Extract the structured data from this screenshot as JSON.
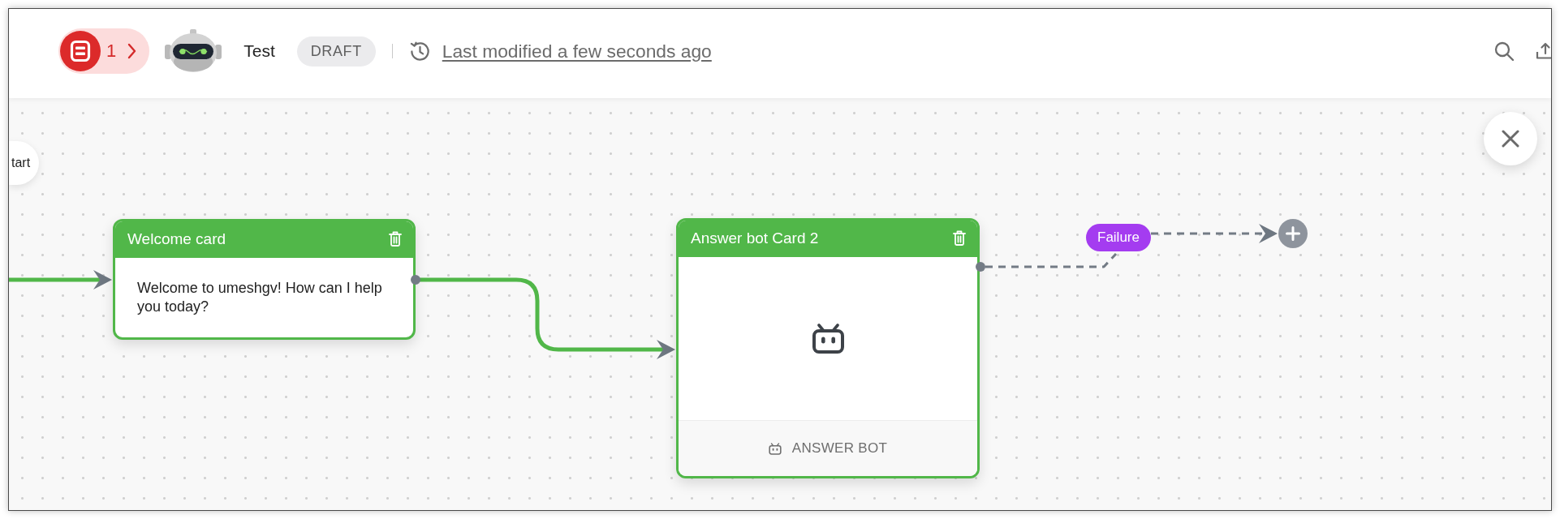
{
  "header": {
    "issue_count": "1",
    "bot_name": "Test",
    "status": "DRAFT",
    "last_modified": "Last modified a few seconds ago"
  },
  "canvas": {
    "nodes": [
      {
        "kind": "start",
        "label": "tart"
      },
      {
        "kind": "message",
        "title": "Welcome card",
        "text": "Welcome to umeshgv! How can I help you today?"
      },
      {
        "kind": "answer_bot",
        "title": "Answer bot Card 2",
        "footer": "ANSWER BOT"
      },
      {
        "kind": "add"
      }
    ],
    "edges": [
      {
        "kind": "solid"
      },
      {
        "kind": "solid"
      },
      {
        "kind": "dashed",
        "label": "Failure"
      }
    ]
  }
}
